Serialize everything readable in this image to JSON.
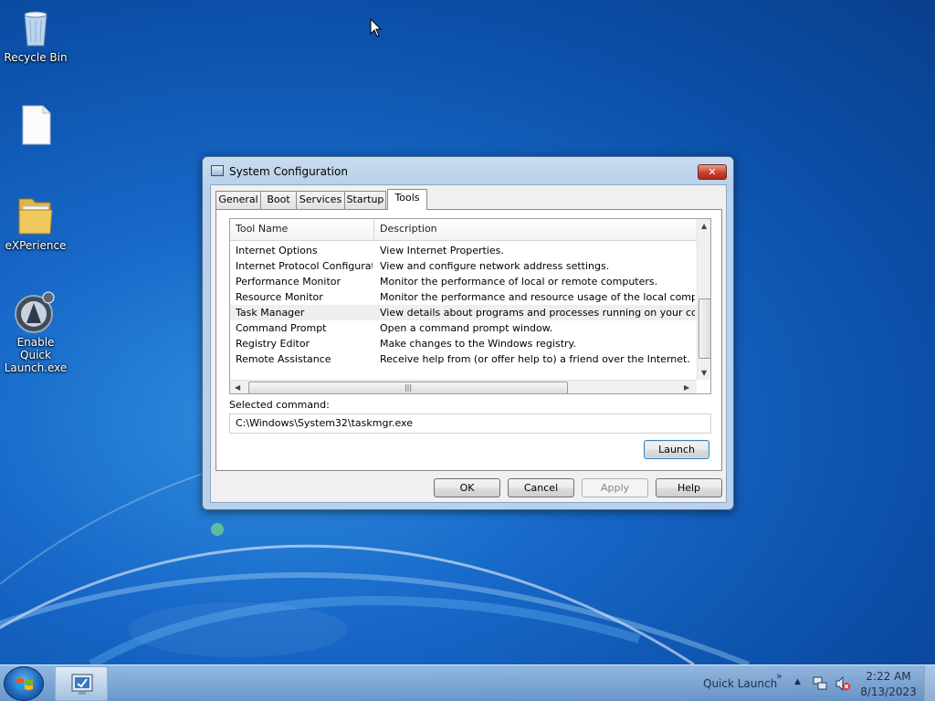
{
  "desktop": {
    "icons": [
      {
        "label": "Recycle Bin",
        "icon": "recycle-bin-icon"
      },
      {
        "label": "",
        "icon": "blank-file-icon"
      },
      {
        "label": "eXPerience",
        "icon": "folder-icon"
      },
      {
        "label": "Enable Quick Launch.exe",
        "icon": "app-exe-icon"
      }
    ]
  },
  "dialog": {
    "title": "System Configuration",
    "close_label": "✕",
    "tabs": [
      {
        "label": "General"
      },
      {
        "label": "Boot"
      },
      {
        "label": "Services"
      },
      {
        "label": "Startup"
      },
      {
        "label": "Tools",
        "active": true
      }
    ],
    "list": {
      "columns": [
        "Tool Name",
        "Description"
      ],
      "rows": [
        {
          "name": "Internet Options",
          "desc": "View Internet Properties."
        },
        {
          "name": "Internet Protocol Configurat...",
          "desc": "View and configure network address settings."
        },
        {
          "name": "Performance Monitor",
          "desc": "Monitor the performance of local or remote computers."
        },
        {
          "name": "Resource Monitor",
          "desc": "Monitor the performance and resource usage of the local computer."
        },
        {
          "name": "Task Manager",
          "desc": "View details about programs and processes running on your computer.",
          "selected": true
        },
        {
          "name": "Command Prompt",
          "desc": "Open a command prompt window."
        },
        {
          "name": "Registry Editor",
          "desc": "Make changes to the Windows registry."
        },
        {
          "name": "Remote Assistance",
          "desc": "Receive help from (or offer help to) a friend over the Internet."
        }
      ]
    },
    "selected_command_label": "Selected command:",
    "selected_command_value": "C:\\Windows\\System32\\taskmgr.exe",
    "launch_label": "Launch",
    "buttons": {
      "ok": "OK",
      "cancel": "Cancel",
      "apply": "Apply",
      "help": "Help"
    }
  },
  "taskbar": {
    "quick_launch": "Quick Launch",
    "chevron": "»",
    "tray_arrow": "▲",
    "time": "2:22 AM",
    "date": "8/13/2023"
  },
  "colors": {
    "desktop_blue": "#1768c8",
    "close_red": "#c7402a",
    "selection": "#efefef"
  }
}
